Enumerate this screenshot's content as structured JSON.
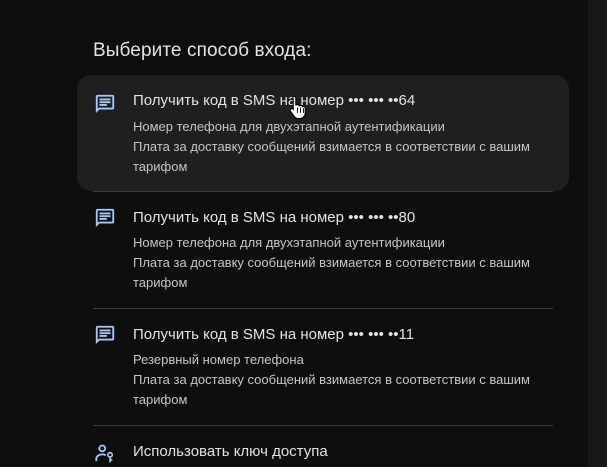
{
  "heading": "Выберите способ входа:",
  "options": [
    {
      "icon": "sms-icon",
      "title": "Получить код в SMS на номер ••• ••• ••64",
      "desc1": "Номер телефона для двухэтапной аутентификации",
      "desc2": "Плата за доставку сообщений взимается в соответствии с вашим тарифом"
    },
    {
      "icon": "sms-icon",
      "title": "Получить код в SMS на номер ••• ••• ••80",
      "desc1": "Номер телефона для двухэтапной аутентификации",
      "desc2": "Плата за доставку сообщений взимается в соответствии с вашим тарифом"
    },
    {
      "icon": "sms-icon",
      "title": "Получить код в SMS на номер ••• ••• ••11",
      "desc1": "Резервный номер телефона",
      "desc2": "Плата за доставку сообщений взимается в соответствии с вашим тарифом"
    },
    {
      "icon": "passkey-icon",
      "title": "Использовать ключ доступа"
    }
  ],
  "colors": {
    "background": "#0e0e0e",
    "hover_background": "#1f1f1f",
    "icon": "#a8c7fa",
    "text_primary": "#e3e3e3",
    "text_secondary": "#c4c7c5",
    "divider": "#3a3a3a"
  }
}
